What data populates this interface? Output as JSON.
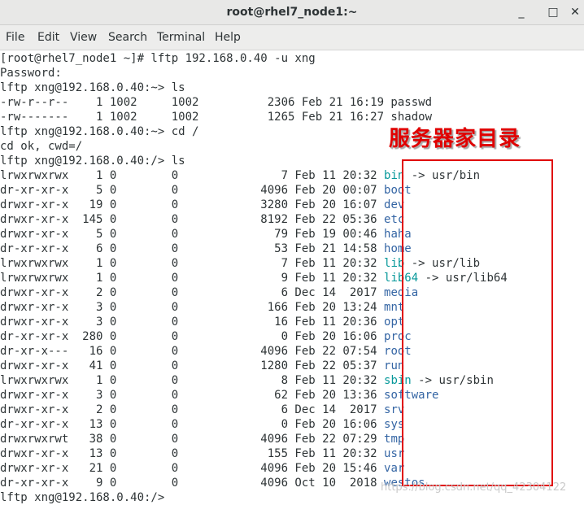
{
  "window": {
    "title": "root@rhel7_node1:~",
    "minimize_glyph": "_",
    "maximize_glyph": "□",
    "close_glyph": "✕"
  },
  "menu": {
    "items": [
      "File",
      "Edit",
      "View",
      "Search",
      "Terminal",
      "Help"
    ]
  },
  "terminal": {
    "header_lines": [
      "[root@rhel7_node1 ~]# lftp 192.168.0.40 -u xng",
      "Password:",
      "lftp xng@192.168.0.40:~> ls",
      "-rw-r--r--    1 1002     1002          2306 Feb 21 16:19 passwd",
      "-rw-------    1 1002     1002          1265 Feb 21 16:27 shadow",
      "lftp xng@192.168.0.40:~> cd /",
      "cd ok, cwd=/",
      "lftp xng@192.168.0.40:/> ls"
    ],
    "listing": [
      {
        "meta": "lrwxrwxrwx    1 0        0               7 Feb 11 20:32 ",
        "name": "bin",
        "link": " -> usr/bin",
        "color": "cyan"
      },
      {
        "meta": "dr-xr-xr-x    5 0        0            4096 Feb 20 00:07 ",
        "name": "boot",
        "link": "",
        "color": "blue"
      },
      {
        "meta": "drwxr-xr-x   19 0        0            3280 Feb 20 16:07 ",
        "name": "dev",
        "link": "",
        "color": "blue"
      },
      {
        "meta": "drwxr-xr-x  145 0        0            8192 Feb 22 05:36 ",
        "name": "etc",
        "link": "",
        "color": "blue"
      },
      {
        "meta": "drwxr-xr-x    5 0        0              79 Feb 19 00:46 ",
        "name": "haha",
        "link": "",
        "color": "blue"
      },
      {
        "meta": "dr-xr-xr-x    6 0        0              53 Feb 21 14:58 ",
        "name": "home",
        "link": "",
        "color": "blue"
      },
      {
        "meta": "lrwxrwxrwx    1 0        0               7 Feb 11 20:32 ",
        "name": "lib",
        "link": " -> usr/lib",
        "color": "cyan"
      },
      {
        "meta": "lrwxrwxrwx    1 0        0               9 Feb 11 20:32 ",
        "name": "lib64",
        "link": " -> usr/lib64",
        "color": "cyan"
      },
      {
        "meta": "drwxr-xr-x    2 0        0               6 Dec 14  2017 ",
        "name": "media",
        "link": "",
        "color": "blue"
      },
      {
        "meta": "drwxr-xr-x    3 0        0             166 Feb 20 13:24 ",
        "name": "mnt",
        "link": "",
        "color": "blue"
      },
      {
        "meta": "drwxr-xr-x    3 0        0              16 Feb 11 20:36 ",
        "name": "opt",
        "link": "",
        "color": "blue"
      },
      {
        "meta": "dr-xr-xr-x  280 0        0               0 Feb 20 16:06 ",
        "name": "proc",
        "link": "",
        "color": "blue"
      },
      {
        "meta": "dr-xr-x---   16 0        0            4096 Feb 22 07:54 ",
        "name": "root",
        "link": "",
        "color": "blue"
      },
      {
        "meta": "drwxr-xr-x   41 0        0            1280 Feb 22 05:37 ",
        "name": "run",
        "link": "",
        "color": "blue"
      },
      {
        "meta": "lrwxrwxrwx    1 0        0               8 Feb 11 20:32 ",
        "name": "sbin",
        "link": " -> usr/sbin",
        "color": "cyan"
      },
      {
        "meta": "drwxr-xr-x    3 0        0              62 Feb 20 13:36 ",
        "name": "software",
        "link": "",
        "color": "blue"
      },
      {
        "meta": "drwxr-xr-x    2 0        0               6 Dec 14  2017 ",
        "name": "srv",
        "link": "",
        "color": "blue"
      },
      {
        "meta": "dr-xr-xr-x   13 0        0               0 Feb 20 16:06 ",
        "name": "sys",
        "link": "",
        "color": "blue"
      },
      {
        "meta": "drwxrwxrwt   38 0        0            4096 Feb 22 07:29 ",
        "name": "tmp",
        "link": "",
        "color": "blue"
      },
      {
        "meta": "drwxr-xr-x   13 0        0             155 Feb 11 20:32 ",
        "name": "usr",
        "link": "",
        "color": "blue"
      },
      {
        "meta": "drwxr-xr-x   21 0        0            4096 Feb 20 15:46 ",
        "name": "var",
        "link": "",
        "color": "blue"
      },
      {
        "meta": "dr-xr-xr-x    9 0        0            4096 Oct 10  2018 ",
        "name": "westos",
        "link": "",
        "color": "blue"
      }
    ],
    "final_prompt": "lftp xng@192.168.0.40:/>"
  },
  "annotation": {
    "text": "服务器家目录",
    "color": "#e00000"
  },
  "watermark": {
    "text": "https://blog.csdn.net/qq_42304122"
  },
  "colors": {
    "cyan_link": "#06989a",
    "blue_dir": "#3465a4",
    "text": "#2e3436"
  }
}
